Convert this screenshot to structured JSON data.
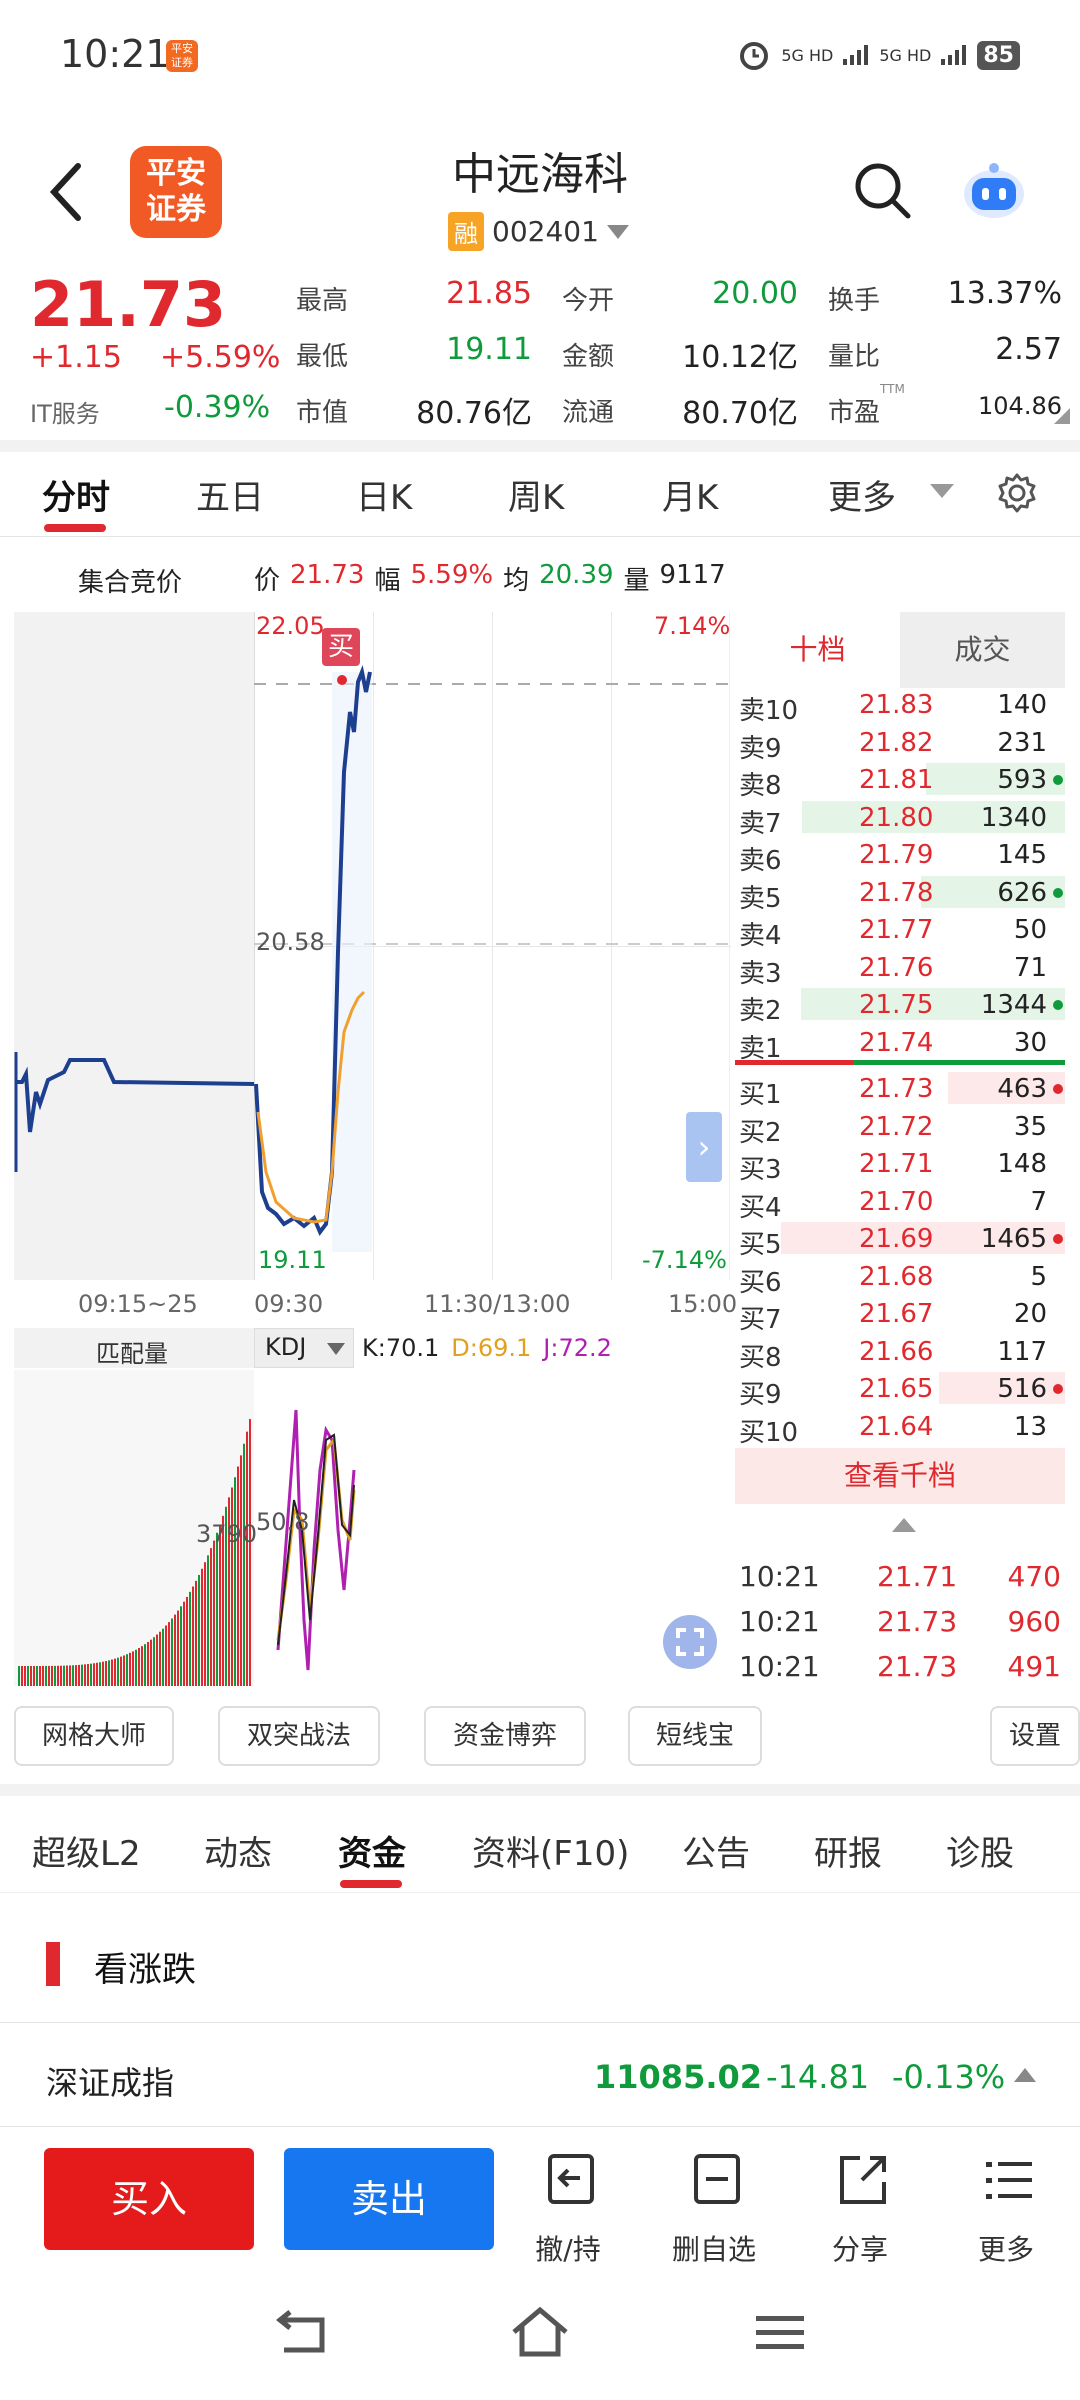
{
  "status": {
    "time": "10:21",
    "app_badge": "平安\n证券",
    "net1": "5G HD",
    "net2": "5G HD",
    "battery": "85"
  },
  "header": {
    "logo_text": "平安\n证券",
    "stock_name": "中远海科",
    "badge": "融",
    "stock_code": "002401"
  },
  "quote": {
    "price": "21.73",
    "change": "+1.15",
    "change_pct": "+5.59%",
    "sector_label": "IT服务",
    "sector_pct": "-0.39%",
    "high_label": "最高",
    "high": "21.85",
    "open_label": "今开",
    "open": "20.00",
    "turnover_label": "换手",
    "turnover": "13.37%",
    "low_label": "最低",
    "low": "19.11",
    "amount_label": "金额",
    "amount": "10.12亿",
    "vol_ratio_label": "量比",
    "vol_ratio": "2.57",
    "mktcap_label": "市值",
    "mktcap": "80.76亿",
    "float_label": "流通",
    "float": "80.70亿",
    "pe_label": "市盈",
    "pe_sup": "TTM",
    "pe": "104.86"
  },
  "tabs": [
    "分时",
    "五日",
    "日K",
    "周K",
    "月K",
    "更多"
  ],
  "chart_info": {
    "auction_label": "集合竞价",
    "price_label": "价",
    "price": "21.73",
    "amp_label": "幅",
    "amp": "5.59%",
    "avg_label": "均",
    "avg": "20.39",
    "vol_label": "量",
    "vol": "9117",
    "top_price": "22.05",
    "mid_price": "20.58",
    "bot_price": "19.11",
    "top_pct": "7.14%",
    "bot_pct": "-7.14%",
    "buy_marker": "买",
    "time_labels": [
      "09:15~25",
      "09:30",
      "11:30/13:00",
      "15:00"
    ],
    "match_label": "匹配量",
    "match_value": "3790",
    "kdj_label": "KDJ",
    "k": "K:70.1",
    "d": "D:69.1",
    "j": "J:72.2",
    "kdj_mid": "50.8"
  },
  "orderbook": {
    "tab_active": "十档",
    "tab_other": "成交",
    "asks": [
      {
        "label": "卖10",
        "price": "21.83",
        "vol": "140",
        "dot": ""
      },
      {
        "label": "卖9",
        "price": "21.82",
        "vol": "231",
        "dot": ""
      },
      {
        "label": "卖8",
        "price": "21.81",
        "vol": "593",
        "dot": "green"
      },
      {
        "label": "卖7",
        "price": "21.80",
        "vol": "1340",
        "dot": ""
      },
      {
        "label": "卖6",
        "price": "21.79",
        "vol": "145",
        "dot": ""
      },
      {
        "label": "卖5",
        "price": "21.78",
        "vol": "626",
        "dot": "green"
      },
      {
        "label": "卖4",
        "price": "21.77",
        "vol": "50",
        "dot": ""
      },
      {
        "label": "卖3",
        "price": "21.76",
        "vol": "71",
        "dot": ""
      },
      {
        "label": "卖2",
        "price": "21.75",
        "vol": "1344",
        "dot": "green"
      },
      {
        "label": "卖1",
        "price": "21.74",
        "vol": "30",
        "dot": ""
      }
    ],
    "bids": [
      {
        "label": "买1",
        "price": "21.73",
        "vol": "463",
        "dot": "red"
      },
      {
        "label": "买2",
        "price": "21.72",
        "vol": "35",
        "dot": ""
      },
      {
        "label": "买3",
        "price": "21.71",
        "vol": "148",
        "dot": ""
      },
      {
        "label": "买4",
        "price": "21.70",
        "vol": "7",
        "dot": ""
      },
      {
        "label": "买5",
        "price": "21.69",
        "vol": "1465",
        "dot": "red"
      },
      {
        "label": "买6",
        "price": "21.68",
        "vol": "5",
        "dot": ""
      },
      {
        "label": "买7",
        "price": "21.67",
        "vol": "20",
        "dot": ""
      },
      {
        "label": "买8",
        "price": "21.66",
        "vol": "117",
        "dot": ""
      },
      {
        "label": "买9",
        "price": "21.65",
        "vol": "516",
        "dot": "red"
      },
      {
        "label": "买10",
        "price": "21.64",
        "vol": "13",
        "dot": ""
      }
    ],
    "more_button": "查看千档",
    "trades": [
      {
        "time": "10:21",
        "price": "21.71",
        "vol": "470"
      },
      {
        "time": "10:21",
        "price": "21.73",
        "vol": "960"
      },
      {
        "time": "10:21",
        "price": "21.73",
        "vol": "491"
      }
    ]
  },
  "tools": [
    "网格大师",
    "双突战法",
    "资金博弈",
    "短线宝",
    "设置"
  ],
  "bottom_tabs": [
    "超级L2",
    "动态",
    "资金",
    "资料(F10)",
    "公告",
    "研报",
    "诊股"
  ],
  "section": {
    "title": "看涨跌"
  },
  "index_row": {
    "name": "深证成指",
    "value": "11085.02",
    "change": "-14.81",
    "pct": "-0.13%"
  },
  "actions": {
    "buy": "买入",
    "sell": "卖出",
    "cancel": "撤/持",
    "del_fav": "删自选",
    "share": "分享",
    "more": "更多"
  },
  "colors": {
    "up": "#e0292e",
    "down": "#0f9b3b",
    "price_line": "#1d3f8f",
    "avg_line": "#f0a030",
    "buy_button": "#e51b1b",
    "sell_button": "#1677f0"
  }
}
